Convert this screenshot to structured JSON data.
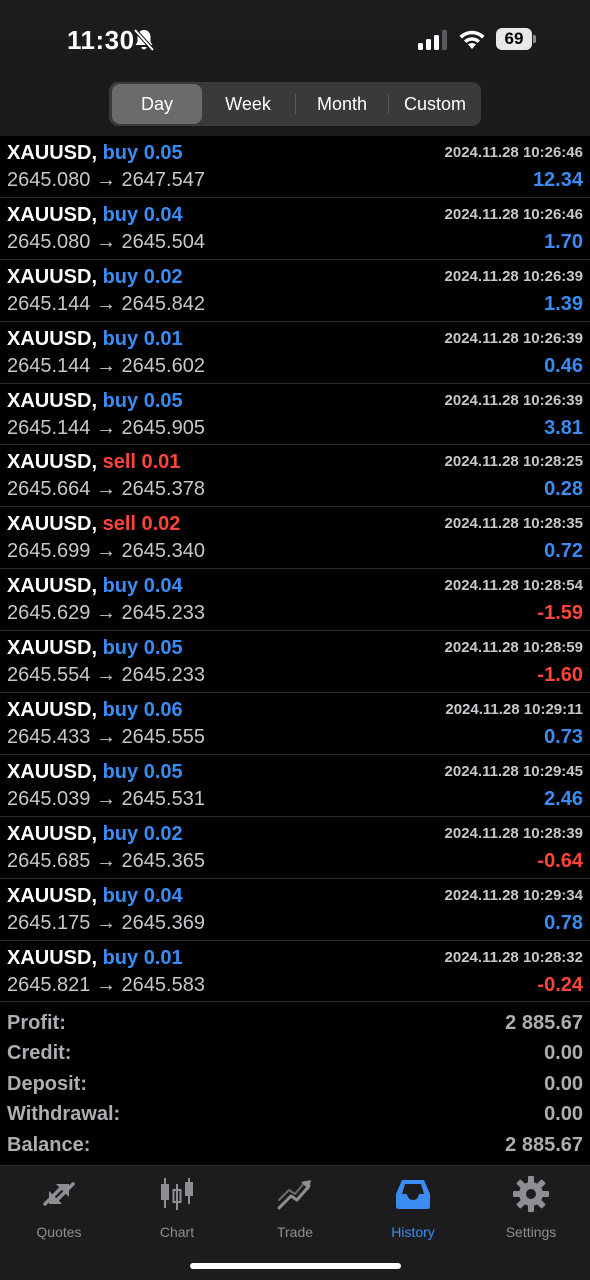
{
  "status_bar": {
    "time": "11:30",
    "battery": "69"
  },
  "periods": {
    "selected": "Day",
    "items": [
      {
        "label": "Day"
      },
      {
        "label": "Week"
      },
      {
        "label": "Month"
      },
      {
        "label": "Custom"
      }
    ]
  },
  "deals": [
    {
      "symbol": "XAUUSD,",
      "side": "buy",
      "volume": "0.05",
      "side_text": "buy 0.05",
      "prices": "2645.080 → 2647.547",
      "time": "2024.11.28 10:26:46",
      "profit": "12.34"
    },
    {
      "symbol": "XAUUSD,",
      "side": "buy",
      "volume": "0.04",
      "side_text": "buy 0.04",
      "prices": "2645.080 → 2645.504",
      "time": "2024.11.28 10:26:46",
      "profit": "1.70"
    },
    {
      "symbol": "XAUUSD,",
      "side": "buy",
      "volume": "0.02",
      "side_text": "buy 0.02",
      "prices": "2645.144 → 2645.842",
      "time": "2024.11.28 10:26:39",
      "profit": "1.39"
    },
    {
      "symbol": "XAUUSD,",
      "side": "buy",
      "volume": "0.01",
      "side_text": "buy 0.01",
      "prices": "2645.144 → 2645.602",
      "time": "2024.11.28 10:26:39",
      "profit": "0.46"
    },
    {
      "symbol": "XAUUSD,",
      "side": "buy",
      "volume": "0.05",
      "side_text": "buy 0.05",
      "prices": "2645.144 → 2645.905",
      "time": "2024.11.28 10:26:39",
      "profit": "3.81"
    },
    {
      "symbol": "XAUUSD,",
      "side": "sell",
      "volume": "0.01",
      "side_text": "sell 0.01",
      "prices": "2645.664 → 2645.378",
      "time": "2024.11.28 10:28:25",
      "profit": "0.28"
    },
    {
      "symbol": "XAUUSD,",
      "side": "sell",
      "volume": "0.02",
      "side_text": "sell 0.02",
      "prices": "2645.699 → 2645.340",
      "time": "2024.11.28 10:28:35",
      "profit": "0.72"
    },
    {
      "symbol": "XAUUSD,",
      "side": "buy",
      "volume": "0.04",
      "side_text": "buy 0.04",
      "prices": "2645.629 → 2645.233",
      "time": "2024.11.28 10:28:54",
      "profit": "-1.59"
    },
    {
      "symbol": "XAUUSD,",
      "side": "buy",
      "volume": "0.05",
      "side_text": "buy 0.05",
      "prices": "2645.554 → 2645.233",
      "time": "2024.11.28 10:28:59",
      "profit": "-1.60"
    },
    {
      "symbol": "XAUUSD,",
      "side": "buy",
      "volume": "0.06",
      "side_text": "buy 0.06",
      "prices": "2645.433 → 2645.555",
      "time": "2024.11.28 10:29:11",
      "profit": "0.73"
    },
    {
      "symbol": "XAUUSD,",
      "side": "buy",
      "volume": "0.05",
      "side_text": "buy 0.05",
      "prices": "2645.039 → 2645.531",
      "time": "2024.11.28 10:29:45",
      "profit": "2.46"
    },
    {
      "symbol": "XAUUSD,",
      "side": "buy",
      "volume": "0.02",
      "side_text": "buy 0.02",
      "prices": "2645.685 → 2645.365",
      "time": "2024.11.28 10:28:39",
      "profit": "-0.64"
    },
    {
      "symbol": "XAUUSD,",
      "side": "buy",
      "volume": "0.04",
      "side_text": "buy 0.04",
      "prices": "2645.175 → 2645.369",
      "time": "2024.11.28 10:29:34",
      "profit": "0.78"
    },
    {
      "symbol": "XAUUSD,",
      "side": "buy",
      "volume": "0.01",
      "side_text": "buy 0.01",
      "prices": "2645.821 → 2645.583",
      "time": "2024.11.28 10:28:32",
      "profit": "-0.24"
    }
  ],
  "summary": [
    {
      "label": "Profit:",
      "value": "2 885.67"
    },
    {
      "label": "Credit:",
      "value": "0.00"
    },
    {
      "label": "Deposit:",
      "value": "0.00"
    },
    {
      "label": "Withdrawal:",
      "value": "0.00"
    },
    {
      "label": "Balance:",
      "value": "2 885.67"
    }
  ],
  "tabbar": {
    "selected": "History",
    "items": [
      {
        "label": "Quotes",
        "icon": "quotes-icon"
      },
      {
        "label": "Chart",
        "icon": "candlestick-chart-icon"
      },
      {
        "label": "Trade",
        "icon": "trade-trend-icon"
      },
      {
        "label": "History",
        "icon": "history-inbox-icon"
      },
      {
        "label": "Settings",
        "icon": "gear-icon"
      }
    ]
  },
  "colors": {
    "accent_blue": "#3b8cf2",
    "loss_red": "#ff453a",
    "background": "#000000",
    "text_gray": "#c7c7cc"
  }
}
